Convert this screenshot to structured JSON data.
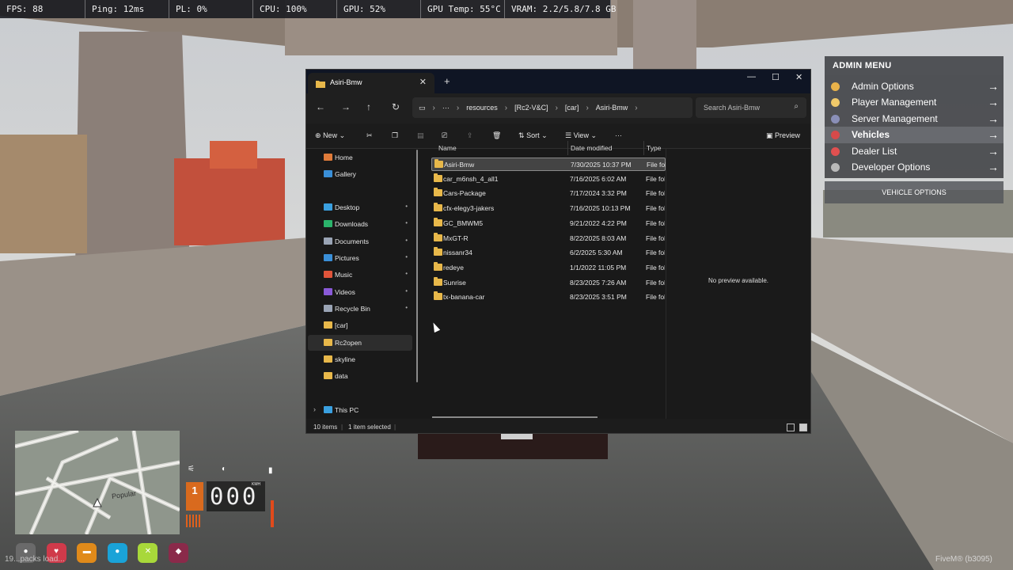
{
  "perf": {
    "fps": "FPS: 88",
    "ping": "Ping: 12ms",
    "pl": "PL: 0%",
    "cpu": "CPU: 100%",
    "gpu": "GPU: 52%",
    "gpu_temp": "GPU Temp: 55°C",
    "vram": "VRAM: 2.2/5.8/7.8 GB"
  },
  "admin_menu": {
    "title": "ADMIN MENU",
    "items": [
      {
        "label": "Admin Options",
        "icon": "smiley-icon",
        "color": "#e9b24a"
      },
      {
        "label": "Player Management",
        "icon": "person-icon",
        "color": "#f0c96a"
      },
      {
        "label": "Server Management",
        "icon": "server-icon",
        "color": "#8a8fb8"
      },
      {
        "label": "Vehicles",
        "icon": "car-icon",
        "color": "#d64a4a",
        "active": true
      },
      {
        "label": "Dealer List",
        "icon": "tag-icon",
        "color": "#e05050"
      },
      {
        "label": "Developer Options",
        "icon": "wrench-icon",
        "color": "#b9b9b9"
      }
    ],
    "arrow": "→",
    "footer": "VEHICLE OPTIONS"
  },
  "explorer": {
    "tab_title": "Asiri-Bmw",
    "close_tab": "✕",
    "new_tab": "+",
    "window_buttons": {
      "minimize": "—",
      "maximize": "☐",
      "close": "✕"
    },
    "nav": {
      "back": "←",
      "forward": "→",
      "up": "↑",
      "refresh": "↻"
    },
    "breadcrumb": {
      "more": "···",
      "parts": [
        "resources",
        "[Rc2-V&C]",
        "[car]",
        "Asiri-Bmw"
      ],
      "sep": "›"
    },
    "search_placeholder": "Search Asiri-Bmw",
    "commands": {
      "new": "New",
      "sort": "Sort",
      "view": "View",
      "more": "···",
      "preview": "Preview"
    },
    "nav_pane": [
      {
        "label": "Home",
        "icon": "home-icon",
        "color": "#e07b3a"
      },
      {
        "label": "Gallery",
        "icon": "gallery-icon",
        "color": "#3a8fd8"
      },
      {
        "label": "Desktop",
        "icon": "desktop-icon",
        "color": "#3aa0e0",
        "pinned": true
      },
      {
        "label": "Downloads",
        "icon": "download-icon",
        "color": "#2bb36b",
        "pinned": true
      },
      {
        "label": "Documents",
        "icon": "documents-icon",
        "color": "#9aa4b5",
        "pinned": true
      },
      {
        "label": "Pictures",
        "icon": "pictures-icon",
        "color": "#3a8fd8",
        "pinned": true
      },
      {
        "label": "Music",
        "icon": "music-icon",
        "color": "#e0543a",
        "pinned": true
      },
      {
        "label": "Videos",
        "icon": "videos-icon",
        "color": "#8a5ad8",
        "pinned": true
      },
      {
        "label": "Recycle Bin",
        "icon": "recycle-bin-icon",
        "color": "#9aa4b5",
        "pinned": true
      },
      {
        "label": "[car]",
        "icon": "folder-icon",
        "color": "#e8b84a"
      },
      {
        "label": "Rc2open",
        "icon": "folder-icon",
        "color": "#e8b84a",
        "selected": true
      },
      {
        "label": "skyline",
        "icon": "folder-icon",
        "color": "#e8b84a"
      },
      {
        "label": "data",
        "icon": "folder-icon",
        "color": "#e8b84a"
      },
      {
        "label": "This PC",
        "icon": "pc-icon",
        "color": "#3aa0e0"
      }
    ],
    "pin_glyph": "📌",
    "columns": {
      "name": "Name",
      "date": "Date modified",
      "type": "Type"
    },
    "files": [
      {
        "name": "Asiri-Bmw",
        "date": "7/30/2025 10:37 PM",
        "type": "File fol",
        "selected": true
      },
      {
        "name": "car_m6nsh_4_all1",
        "date": "7/16/2025 6:02 AM",
        "type": "File fol"
      },
      {
        "name": "Cars-Package",
        "date": "7/17/2024 3:32 PM",
        "type": "File fol"
      },
      {
        "name": "cfx-elegy3-jakers",
        "date": "7/16/2025 10:13 PM",
        "type": "File fol"
      },
      {
        "name": "GC_BMWM5",
        "date": "9/21/2022 4:22 PM",
        "type": "File fol"
      },
      {
        "name": "MxGT-R",
        "date": "8/22/2025 8:03 AM",
        "type": "File fol"
      },
      {
        "name": "nissanr34",
        "date": "6/2/2025 5:30 AM",
        "type": "File fol"
      },
      {
        "name": "redeye",
        "date": "1/1/2022 11:05 PM",
        "type": "File fol"
      },
      {
        "name": "Sunrise",
        "date": "8/23/2025 7:26 AM",
        "type": "File fol"
      },
      {
        "name": "tx-banana-car",
        "date": "8/23/2025 3:51 PM",
        "type": "File fol"
      }
    ],
    "preview_message": "No preview available.",
    "status": {
      "count": "10 items",
      "selected": "1 item selected"
    }
  },
  "hud": {
    "gear": "1",
    "speed": "000",
    "unit": "KMH",
    "minimap_label": "Popular",
    "status_icons": [
      {
        "icon": "person-status-icon",
        "color": "#6a6a6a",
        "glyph": "●"
      },
      {
        "icon": "health-icon",
        "color": "#d03a4a",
        "glyph": "♥"
      },
      {
        "icon": "food-icon",
        "color": "#e08a1a",
        "glyph": "▬"
      },
      {
        "icon": "water-icon",
        "color": "#1aa3d8",
        "glyph": "●"
      },
      {
        "icon": "stamina-icon",
        "color": "#a8d83a",
        "glyph": "✕"
      },
      {
        "icon": "stress-icon",
        "color": "#8a2a4a",
        "glyph": "◆"
      }
    ],
    "loading_text": "19...packs load...",
    "fivem_text": "FiveM® (b3095)"
  }
}
